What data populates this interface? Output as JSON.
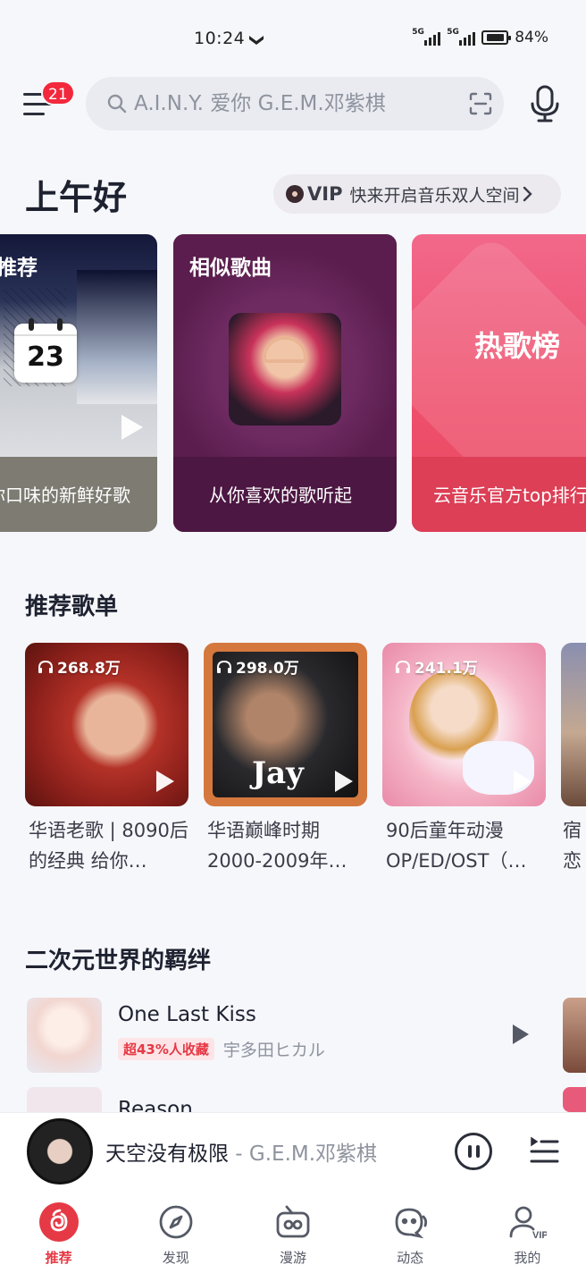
{
  "status_bar": {
    "time": "10:24",
    "signal_1": "5G",
    "signal_2": "5G",
    "battery": "84%"
  },
  "header": {
    "menu_badge": "21",
    "search_placeholder": "A.I.N.Y. 爱你 G.E.M.邓紫棋"
  },
  "greeting": "上午好",
  "vip_banner": {
    "badge": "VIP",
    "text": "快来开启音乐双人空间"
  },
  "cards": [
    {
      "title": "推荐",
      "date": "23",
      "caption": "你口味的新鲜好歌"
    },
    {
      "title": "相似歌曲",
      "caption": "从你喜欢的歌听起"
    },
    {
      "title": "热歌榜",
      "caption": "云音乐官方top排行"
    }
  ],
  "recommended_playlists": {
    "title": "推荐歌单",
    "items": [
      {
        "count": "268.8万",
        "title": "华语老歌 | 8090后的经典 给你…"
      },
      {
        "count": "298.0万",
        "title": "华语巅峰时期2000-2009年…"
      },
      {
        "count": "241.1万",
        "title": "90后童年动漫OP/ED/OST（…"
      },
      {
        "count": "",
        "title": "宿恋"
      }
    ]
  },
  "anime_section": {
    "title": "二次元世界的羁绊",
    "songs": [
      {
        "name": "One Last Kiss",
        "tag": "超43%人收藏",
        "artist": "宇多田ヒカル"
      },
      {
        "name": "Reason",
        "tag": "",
        "artist": ""
      }
    ]
  },
  "mini_player": {
    "song": "天空没有极限",
    "artist": " - G.E.M.邓紫棋"
  },
  "bottom_nav": [
    {
      "label": "推荐",
      "active": true
    },
    {
      "label": "发现",
      "active": false
    },
    {
      "label": "漫游",
      "active": false
    },
    {
      "label": "动态",
      "active": false
    },
    {
      "label": "我的",
      "active": false
    }
  ],
  "colors": {
    "accent": "#e53945",
    "badge": "#f2283c",
    "background": "#f6f7fb"
  }
}
